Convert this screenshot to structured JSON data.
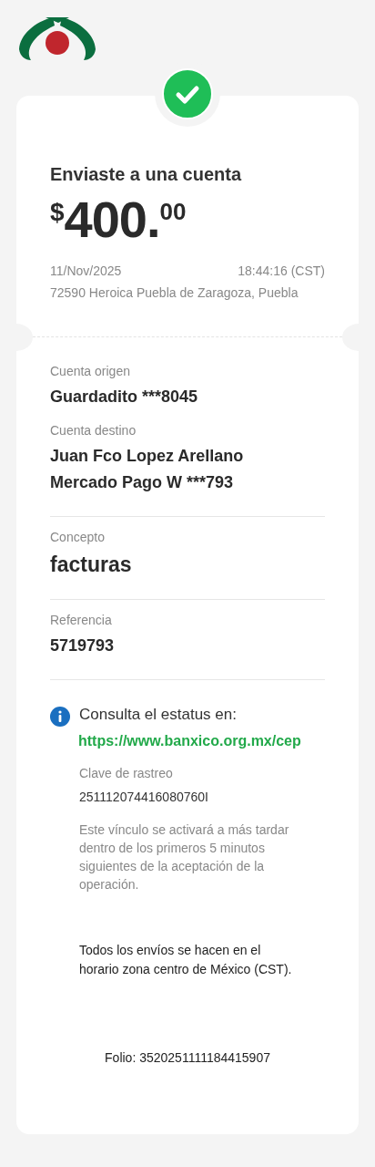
{
  "header": {
    "title": "Enviaste a una cuenta",
    "amount": {
      "currency": "$",
      "integer": "400.",
      "cents": "00"
    },
    "date": "11/Nov/2025",
    "time": "18:44:16 (CST)",
    "location": "72590 Heroica Puebla de Zaragoza, Puebla"
  },
  "sections": [
    {
      "fields": [
        {
          "label": "Cuenta origen",
          "kind": "normal",
          "lines": [
            "Guardadito ***8045"
          ]
        },
        {
          "label": "Cuenta destino",
          "kind": "normal",
          "lines": [
            "Juan Fco Lopez Arellano",
            "Mercado Pago W ***793"
          ]
        }
      ]
    },
    {
      "fields": [
        {
          "label": "Concepto",
          "kind": "large",
          "lines": [
            "facturas"
          ]
        }
      ]
    },
    {
      "fields": [
        {
          "label": "Referencia",
          "kind": "normal",
          "lines": [
            "5719793"
          ]
        }
      ]
    }
  ],
  "status_info": {
    "text": "Consulta el estatus en:",
    "link": "https://www.banxico.org.mx/cep",
    "tracking_label": "Clave de rastreo",
    "tracking_value": "251112074416080760I",
    "note": "Este vínculo se activará a más tardar dentro de los primeros 5 minutos siguientes de la aceptación de la operación."
  },
  "notice": "Todos los envíos se hacen en el horario zona centro de México (CST).",
  "folio": "Folio: 3520251111184415907"
}
